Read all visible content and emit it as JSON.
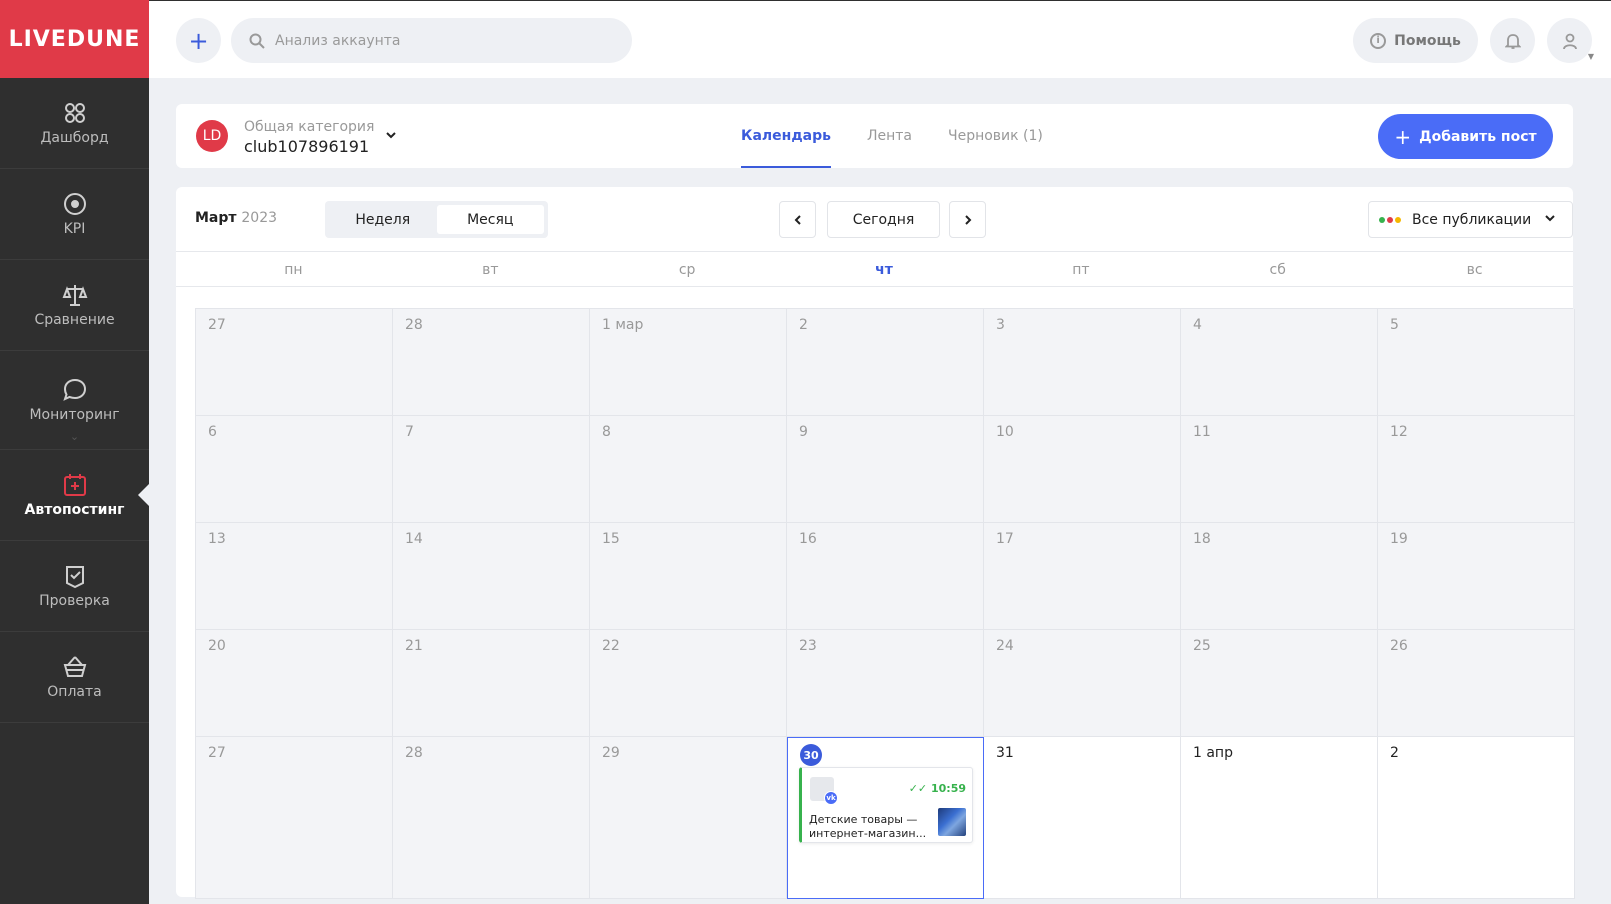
{
  "sidebar": {
    "logo": "LIVEDUNE",
    "items": [
      {
        "label": "Дашборд",
        "icon": "dashboard-icon"
      },
      {
        "label": "KPI",
        "icon": "kpi-icon"
      },
      {
        "label": "Сравнение",
        "icon": "scales-icon"
      },
      {
        "label": "Мониторинг",
        "icon": "chat-bubble-icon"
      },
      {
        "label": "Автопостинг",
        "icon": "calendar-plus-icon",
        "active": true
      },
      {
        "label": "Проверка",
        "icon": "clipboard-check-icon"
      },
      {
        "label": "Оплата",
        "icon": "basket-icon"
      }
    ]
  },
  "topbar": {
    "search_placeholder": "Анализ аккаунта",
    "help_label": "Помощь"
  },
  "account": {
    "avatar_initials": "LD",
    "category": "Общая категория",
    "name": "club107896191",
    "tabs": [
      {
        "label": "Календарь",
        "active": true
      },
      {
        "label": "Лента"
      },
      {
        "label": "Черновик (1)"
      }
    ],
    "add_post_label": "Добавить пост"
  },
  "calendar": {
    "month": "Март",
    "year": "2023",
    "view_week": "Неделя",
    "view_month": "Месяц",
    "today_label": "Сегодня",
    "filter_label": "Все публикации",
    "filter_dot_colors": [
      "#37b24d",
      "#e03a48",
      "#f5b700"
    ],
    "weekdays": [
      "пн",
      "вт",
      "ср",
      "чт",
      "пт",
      "сб",
      "вс"
    ],
    "today_weekday_index": 3,
    "weeks": [
      [
        "27",
        "28",
        "1 мар",
        "2",
        "3",
        "4",
        "5"
      ],
      [
        "6",
        "7",
        "8",
        "9",
        "10",
        "11",
        "12"
      ],
      [
        "13",
        "14",
        "15",
        "16",
        "17",
        "18",
        "19"
      ],
      [
        "20",
        "21",
        "22",
        "23",
        "24",
        "25",
        "26"
      ],
      [
        "27",
        "28",
        "29",
        "30",
        "31",
        "1 апр",
        "2"
      ]
    ],
    "post": {
      "time": "10:59",
      "network_badge": "vk",
      "text_line1": "Детские товары —",
      "text_line2": "интернет-магазин..."
    },
    "accent_color": "#3b5bdb",
    "brand_color": "#e03a48"
  }
}
